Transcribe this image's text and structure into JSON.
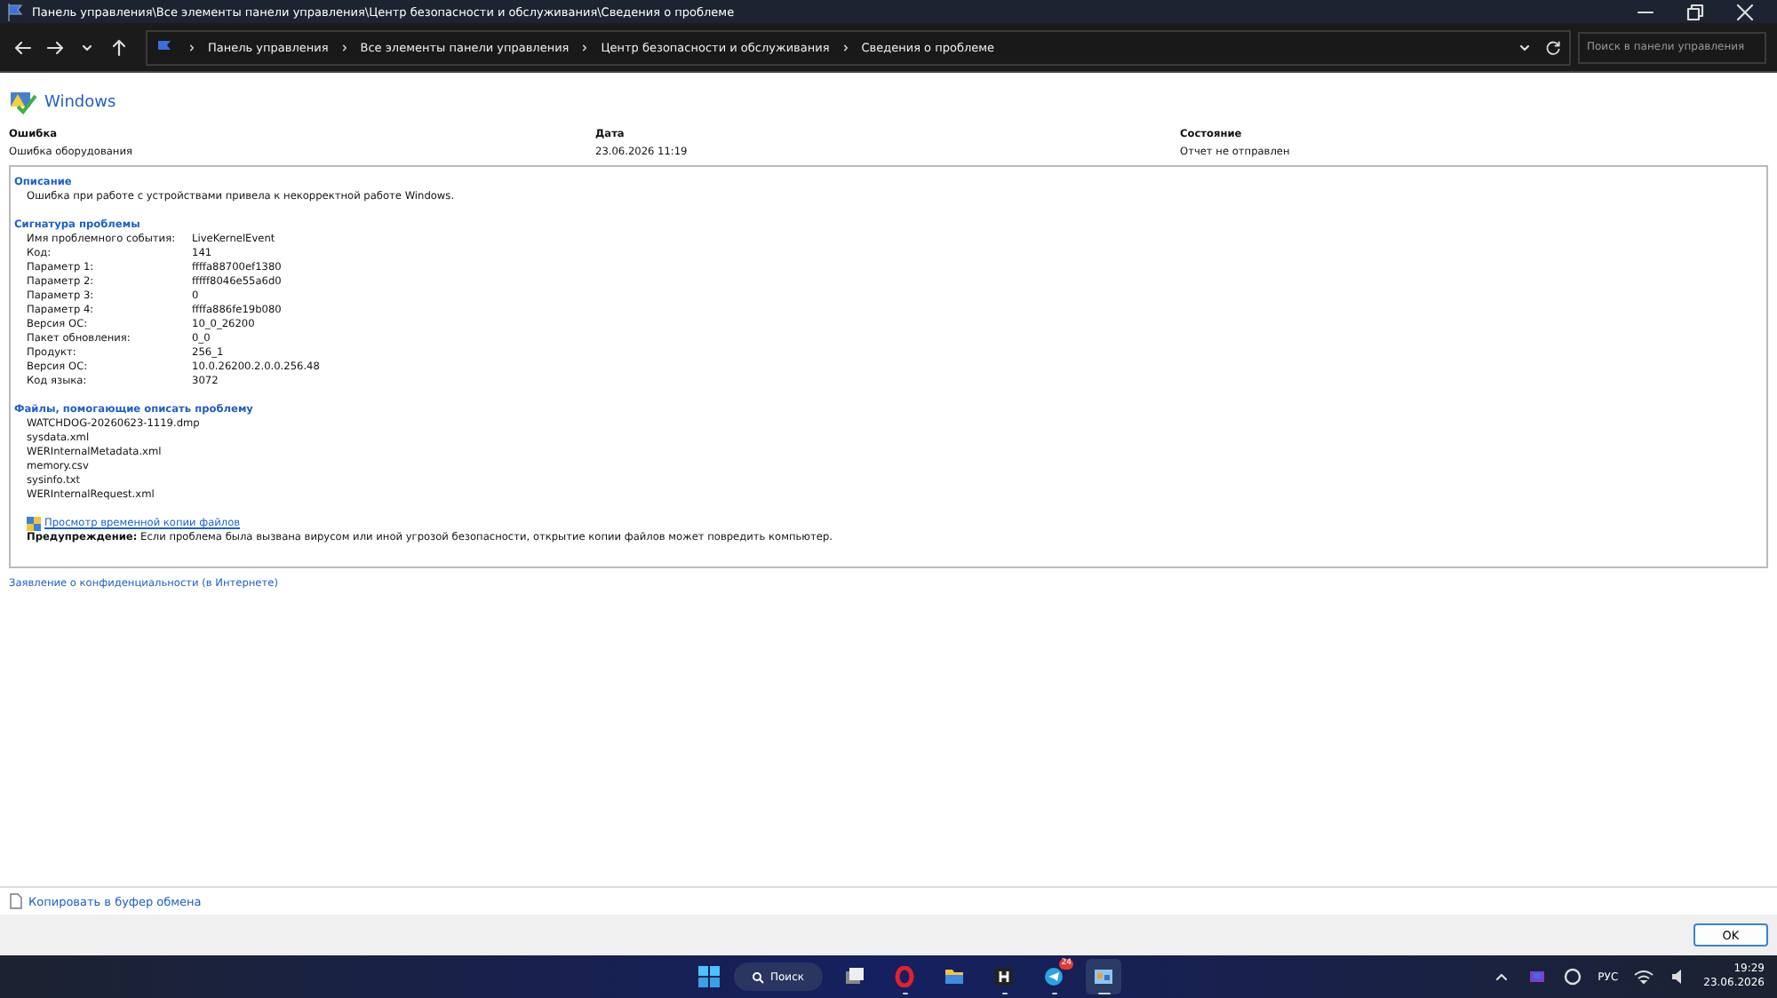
{
  "window": {
    "title": "Панель управления\\Все элементы панели управления\\Центр безопасности и обслуживания\\Сведения о проблеме"
  },
  "breadcrumbs": [
    "Панель управления",
    "Все элементы панели управления",
    "Центр безопасности и обслуживания",
    "Сведения о проблеме"
  ],
  "search": {
    "placeholder": "Поиск в панели управления"
  },
  "brand": "Windows",
  "summary": [
    {
      "label": "Ошибка",
      "value": "Ошибка оборудования"
    },
    {
      "label": "Дата",
      "value": "23.06.2026 11:19"
    },
    {
      "label": "Состояние",
      "value": "Отчет не отправлен"
    }
  ],
  "description": {
    "heading": "Описание",
    "text": "Ошибка при работе с устройствами привела к некорректной работе Windows."
  },
  "signature": {
    "heading": "Сигнатура проблемы",
    "rows": [
      {
        "label": "Имя проблемного события:",
        "value": "LiveKernelEvent"
      },
      {
        "label": "Код:",
        "value": "141"
      },
      {
        "label": "Параметр 1:",
        "value": "ffffa88700ef1380"
      },
      {
        "label": "Параметр 2:",
        "value": "fffff8046e55a6d0"
      },
      {
        "label": "Параметр 3:",
        "value": "0"
      },
      {
        "label": "Параметр 4:",
        "value": "ffffa886fe19b080"
      },
      {
        "label": "Версия ОС:",
        "value": "10_0_26200"
      },
      {
        "label": "Пакет обновления:",
        "value": "0_0"
      },
      {
        "label": "Продукт:",
        "value": "256_1"
      },
      {
        "label": "Версия ОС:",
        "value": "10.0.26200.2.0.0.256.48"
      },
      {
        "label": "Код языка:",
        "value": "3072"
      }
    ]
  },
  "files": {
    "heading": "Файлы, помогающие описать проблему",
    "items": [
      "WATCHDOG-20260623-1119.dmp",
      "sysdata.xml",
      "WERInternalMetadata.xml",
      "memory.csv",
      "sysinfo.txt",
      "WERInternalRequest.xml"
    ],
    "view_link": "Просмотр временной копии файлов",
    "warning": "**Предупреждение:** Если проблема была вызвана вирусом или иной угрозой безопасности, открытие копии файлов может повредить компьютер."
  },
  "privacy_link": "Заявление о конфиденциальности (в Интернете)",
  "copy_link": "Копировать в буфер обмена",
  "ok_button": "OK",
  "taskbar": {
    "search": "Поиск",
    "apps": [
      {
        "kind": "taskview",
        "active": false,
        "running": false
      },
      {
        "kind": "opera",
        "active": false,
        "running": true
      },
      {
        "kind": "folder",
        "active": false,
        "running": false
      },
      {
        "kind": "h",
        "active": false,
        "running": true
      },
      {
        "kind": "telegram",
        "active": false,
        "running": true,
        "badge": "24"
      },
      {
        "kind": "control",
        "active": true,
        "running": true
      }
    ],
    "language": "РУС",
    "time": "19:29",
    "date": "23.06.2026"
  }
}
